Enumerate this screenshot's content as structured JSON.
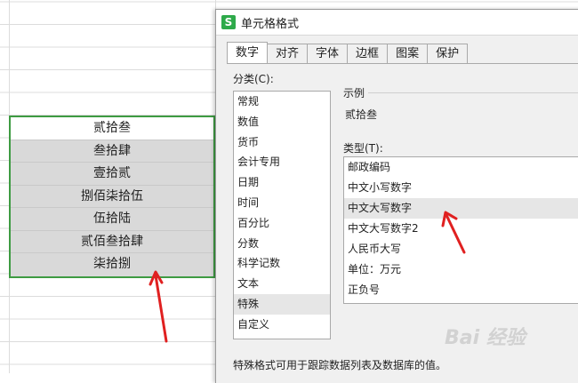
{
  "dialog": {
    "title": "单元格格式",
    "icon_letter": "S",
    "tabs": [
      {
        "label": "数字",
        "active": true
      },
      {
        "label": "对齐"
      },
      {
        "label": "字体"
      },
      {
        "label": "边框"
      },
      {
        "label": "图案"
      },
      {
        "label": "保护"
      }
    ],
    "category_label": "分类(C):",
    "categories": [
      "常规",
      "数值",
      "货币",
      "会计专用",
      "日期",
      "时间",
      "百分比",
      "分数",
      "科学记数",
      "文本",
      "特殊",
      "自定义"
    ],
    "selected_category": "特殊",
    "sample_label": "示例",
    "sample_value": "贰拾叁",
    "type_label": "类型(T):",
    "types": [
      "邮政编码",
      "中文小写数字",
      "中文大写数字",
      "中文大写数字2",
      "人民币大写",
      "单位：万元",
      "正负号"
    ],
    "selected_type": "中文大写数字",
    "footer": "特殊格式可用于跟踪数据列表及数据库的值。"
  },
  "sheet": {
    "cells": [
      "贰拾叁",
      "叁拾肆",
      "壹拾贰",
      "捌佰柒拾伍",
      "伍拾陆",
      "贰佰叁拾肆",
      "柒拾捌"
    ]
  },
  "watermark": "Bai 经验"
}
